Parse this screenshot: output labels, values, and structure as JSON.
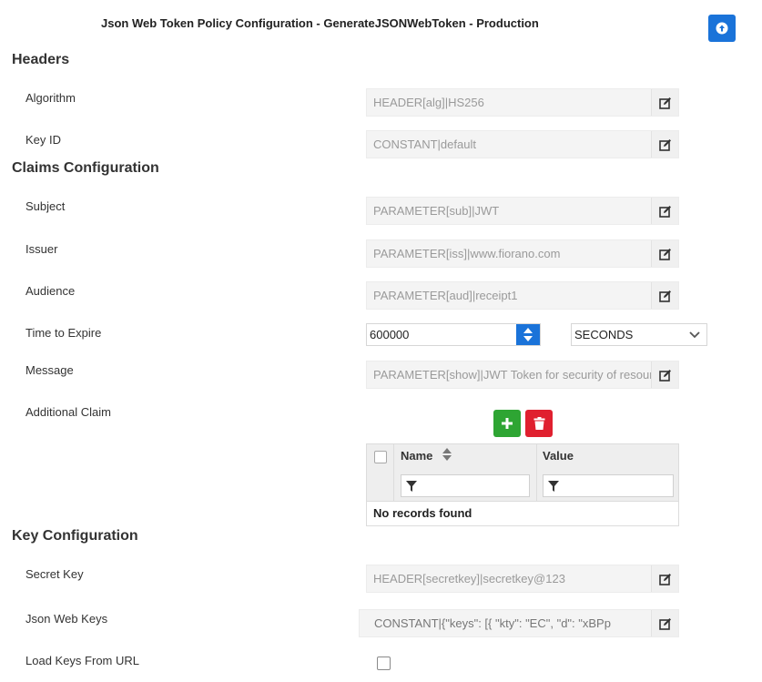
{
  "page": {
    "title": "Json Web Token Policy Configuration - GenerateJSONWebToken - Production"
  },
  "sections": {
    "headers": "Headers",
    "claims": "Claims Configuration",
    "key": "Key Configuration"
  },
  "headers": {
    "algorithm": {
      "label": "Algorithm",
      "value": "HEADER[alg]|HS256"
    },
    "key_id": {
      "label": "Key ID",
      "value": "CONSTANT|default"
    }
  },
  "claims": {
    "subject": {
      "label": "Subject",
      "value": "PARAMETER[sub]|JWT"
    },
    "issuer": {
      "label": "Issuer",
      "value": "PARAMETER[iss]|www.fiorano.com"
    },
    "audience": {
      "label": "Audience",
      "value": "PARAMETER[aud]|receipt1"
    },
    "time_to_expire": {
      "label": "Time to Expire",
      "value": "600000",
      "unit": "SECONDS"
    },
    "message": {
      "label": "Message",
      "value": "PARAMETER[show]|JWT Token for security of resources"
    },
    "additional_claim": {
      "label": "Additional Claim",
      "columns": {
        "name": "Name",
        "value": "Value"
      },
      "empty_text": "No records found"
    }
  },
  "key_config": {
    "secret_key": {
      "label": "Secret Key",
      "value": "HEADER[secretkey]|secretkey@123"
    },
    "json_web_keys": {
      "label": "Json Web Keys",
      "value": "CONSTANT|{\"keys\":       [{   \"kty\": \"EC\",   \"d\": \"xBPp"
    },
    "load_keys_from_url": {
      "label": "Load Keys From URL",
      "checked": false
    }
  },
  "icons": {
    "upload": "arrow-up-circle-icon",
    "edit": "pencil-square-icon",
    "add": "plus-icon",
    "delete": "trash-icon",
    "filter": "funnel-icon",
    "sort": "sort-icon",
    "dropdown": "chevron-down-icon"
  },
  "colors": {
    "primary": "#1a73d9",
    "success": "#2ea533",
    "danger": "#e0202f",
    "readonly_bg": "#f4f4f4",
    "readonly_text": "#9a9a9a"
  }
}
